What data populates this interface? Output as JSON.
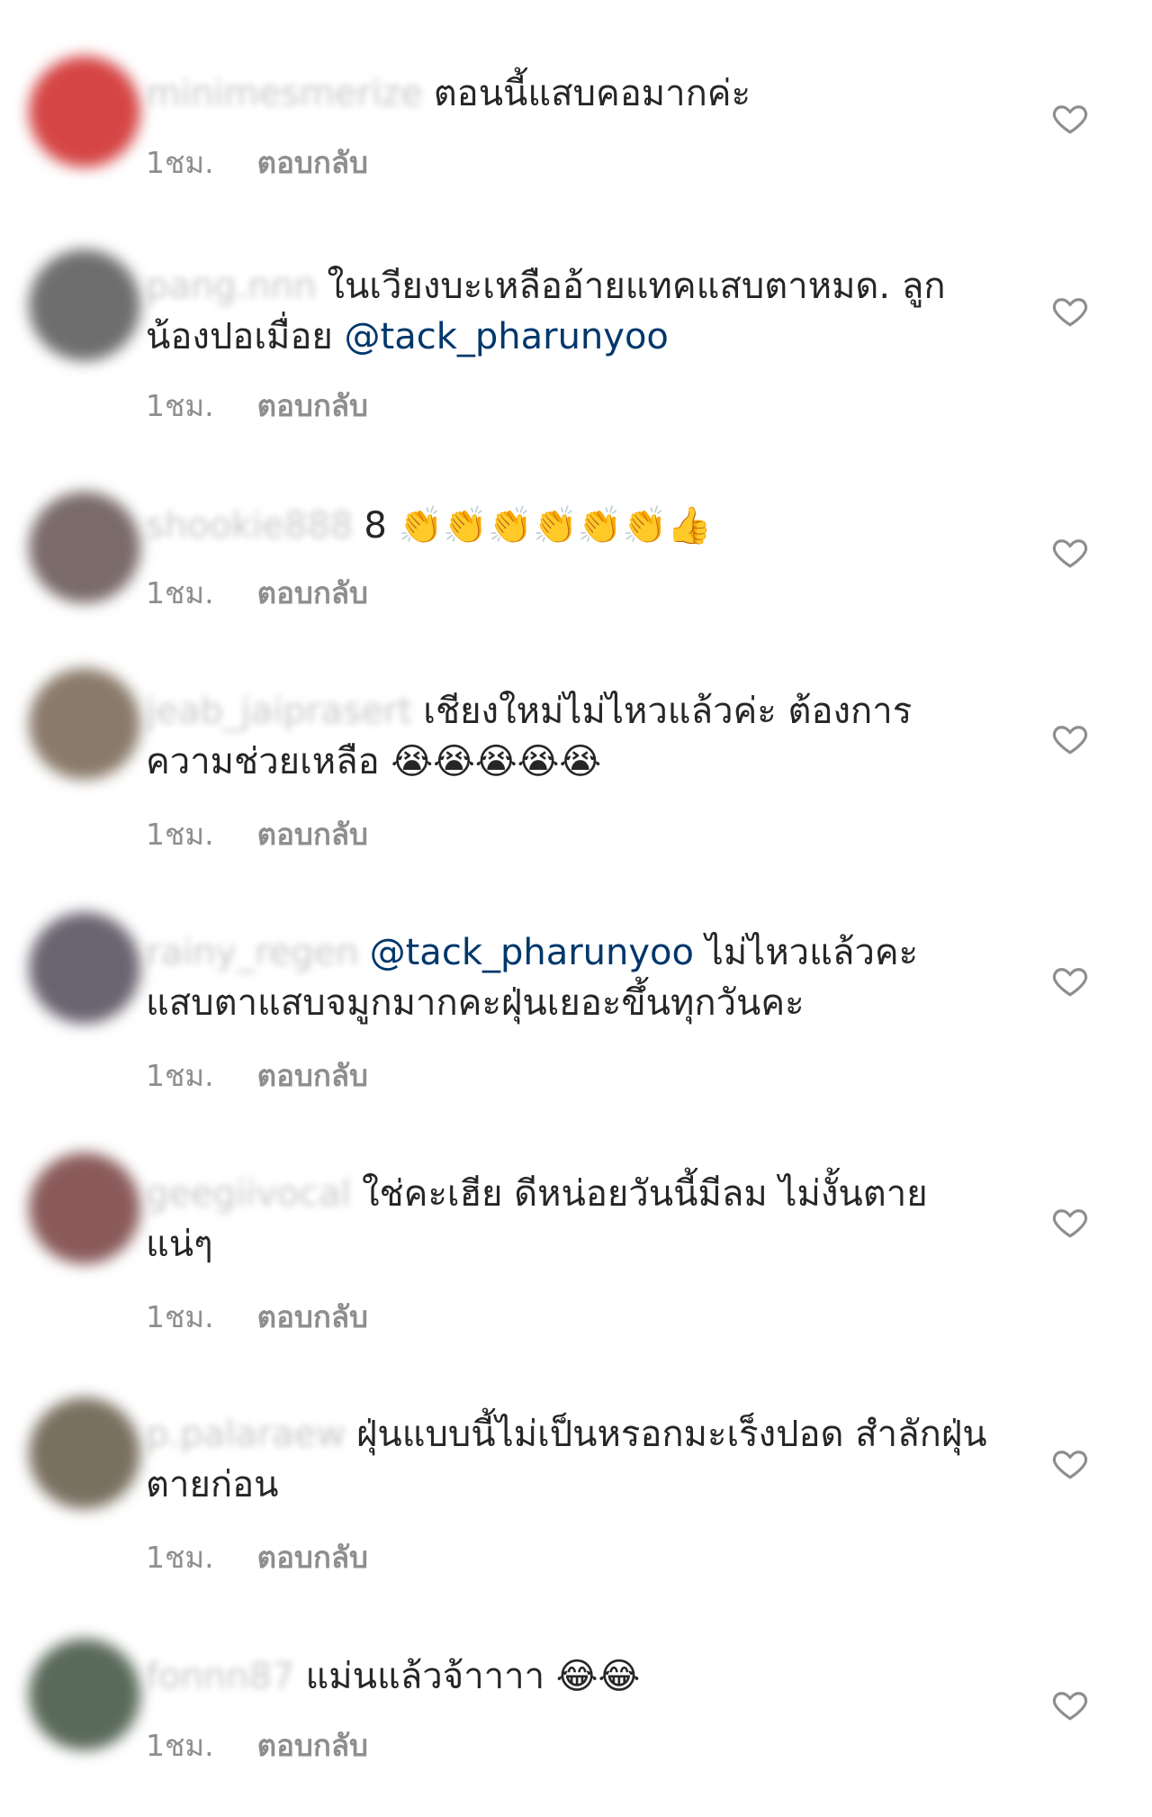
{
  "comments": [
    {
      "username": "minimesmerize",
      "text": "ตอนนี้แสบคอมากค่ะ",
      "mention": "",
      "after_mention": "",
      "emoji": "",
      "time": "1ชม.",
      "reply": "ตอบกลับ",
      "avatar_color": "#d64545"
    },
    {
      "username": "pang.nnn",
      "text": "ในเวียงบะเหลืออ้ายแทคแสบตาหมด. ลูกน้องปอเมื่อย ",
      "mention": "@tack_pharunyoo",
      "after_mention": "",
      "emoji": "",
      "time": "1ชม.",
      "reply": "ตอบกลับ",
      "avatar_color": "#6e6e6e"
    },
    {
      "username": "shookie888",
      "text": "8 ",
      "mention": "",
      "after_mention": "",
      "emoji": "👏👏👏👏👏👏👍",
      "time": "1ชม.",
      "reply": "ตอบกลับ",
      "avatar_color": "#7a6a6a"
    },
    {
      "username": "jeab_jaiprasert",
      "text": "เชียงใหม่ไม่ไหวแล้วค่ะ ต้องการความช่วยเหลือ ",
      "mention": "",
      "after_mention": "",
      "emoji": "😭😭😭😭😭",
      "time": "1ชม.",
      "reply": "ตอบกลับ",
      "avatar_color": "#8a7a6a"
    },
    {
      "username": "rainy_regen",
      "text": "",
      "mention": "@tack_pharunyoo",
      "after_mention": " ไม่ไหวแล้วคะ แสบตาแสบจมูกมากคะฝุ่นเยอะขึ้นทุกวันคะ",
      "emoji": "",
      "time": "1ชม.",
      "reply": "ตอบกลับ",
      "avatar_color": "#6a6470"
    },
    {
      "username": "geegiivocal",
      "text": "ใช่คะเฮีย ดีหน่อยวันนี้มีลม ไม่งั้นตายแน่ๆ",
      "mention": "",
      "after_mention": "",
      "emoji": "",
      "time": "1ชม.",
      "reply": "ตอบกลับ",
      "avatar_color": "#8a5a5a"
    },
    {
      "username": "p.palaraew",
      "text": "ฝุ่นแบบนี้ไม่เป็นหรอกมะเร็งปอด สำลักฝุ่นตายก่อน",
      "mention": "",
      "after_mention": "",
      "emoji": "",
      "time": "1ชม.",
      "reply": "ตอบกลับ",
      "avatar_color": "#7a7060"
    },
    {
      "username": "fonnn87",
      "text": "แม่นแล้วจ้าาาา ",
      "mention": "",
      "after_mention": "",
      "emoji": "😂😂",
      "time": "1ชม.",
      "reply": "ตอบกลับ",
      "avatar_color": "#5a6a5a"
    }
  ]
}
